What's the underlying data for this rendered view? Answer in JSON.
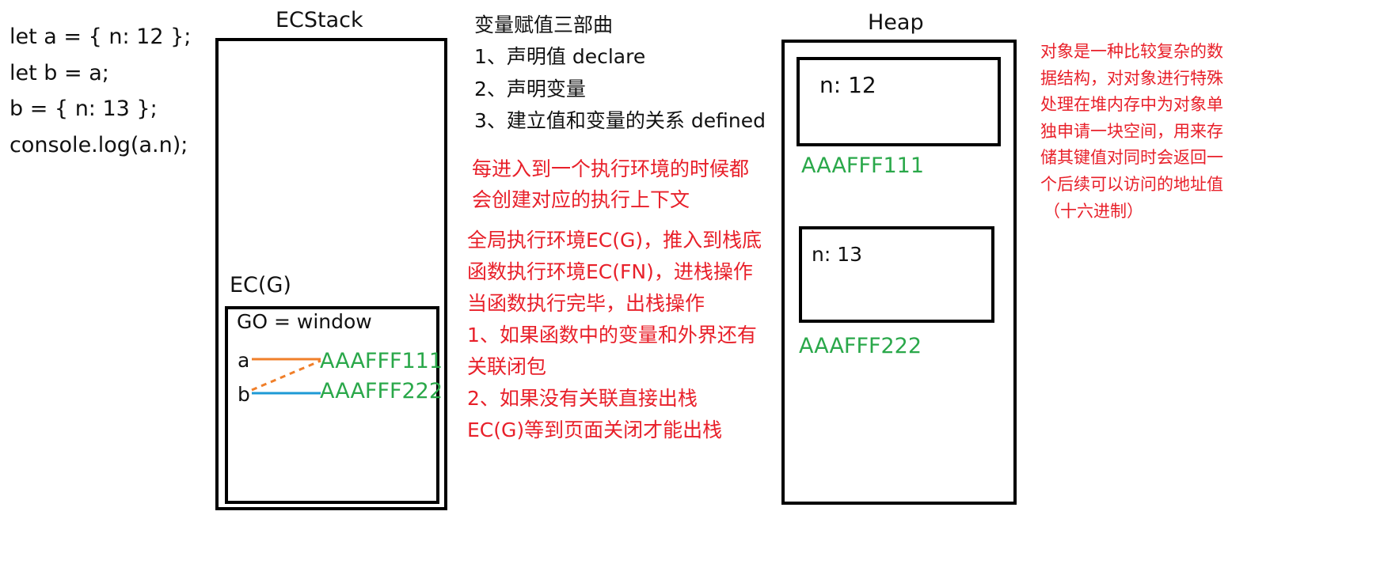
{
  "code": {
    "lines": [
      "let a = { n: 12 };",
      "let b = a;",
      "b = { n: 13 };",
      "console.log(a.n);"
    ]
  },
  "ecstack": {
    "title": "ECStack",
    "ec_label": "EC(G)",
    "go_label": "GO = window",
    "var_a": "a",
    "var_b": "b",
    "ref_a": "AAAFFF111",
    "ref_b": "AAAFFF222"
  },
  "steps": {
    "title": "变量赋值三部曲",
    "items": [
      "1、声明值 declare",
      "2、声明变量",
      "3、建立值和变量的关系 defined"
    ]
  },
  "ec_notes": {
    "lines": [
      "每进入到一个执行环境的时候都",
      "会创建对应的执行上下文"
    ]
  },
  "stack_notes": {
    "lines": [
      "全局执行环境EC(G)，推入到栈底",
      "函数执行环境EC(FN)，进栈操作",
      "当函数执行完毕，出栈操作",
      "1、如果函数中的变量和外界还有",
      "关联闭包",
      "2、如果没有关联直接出栈",
      "EC(G)等到页面关闭才能出栈"
    ]
  },
  "heap": {
    "title": "Heap",
    "obj1_content": "n: 12",
    "obj1_addr": "AAAFFF111",
    "obj2_content": "n: 13",
    "obj2_addr": "AAAFFF222"
  },
  "object_note": {
    "lines": [
      "对象是一种比较复杂的数",
      "据结构，对对象进行特殊",
      "处理在堆内存中为对象单",
      "独申请一块空间，用来存",
      "储其键值对同时会返回一",
      "个后续可以访问的地址值",
      "（十六进制）"
    ]
  },
  "colors": {
    "green": "#2aa84a",
    "red": "#e8202a",
    "orange_link": "#f07f2a",
    "blue_link": "#1e9ad6"
  }
}
